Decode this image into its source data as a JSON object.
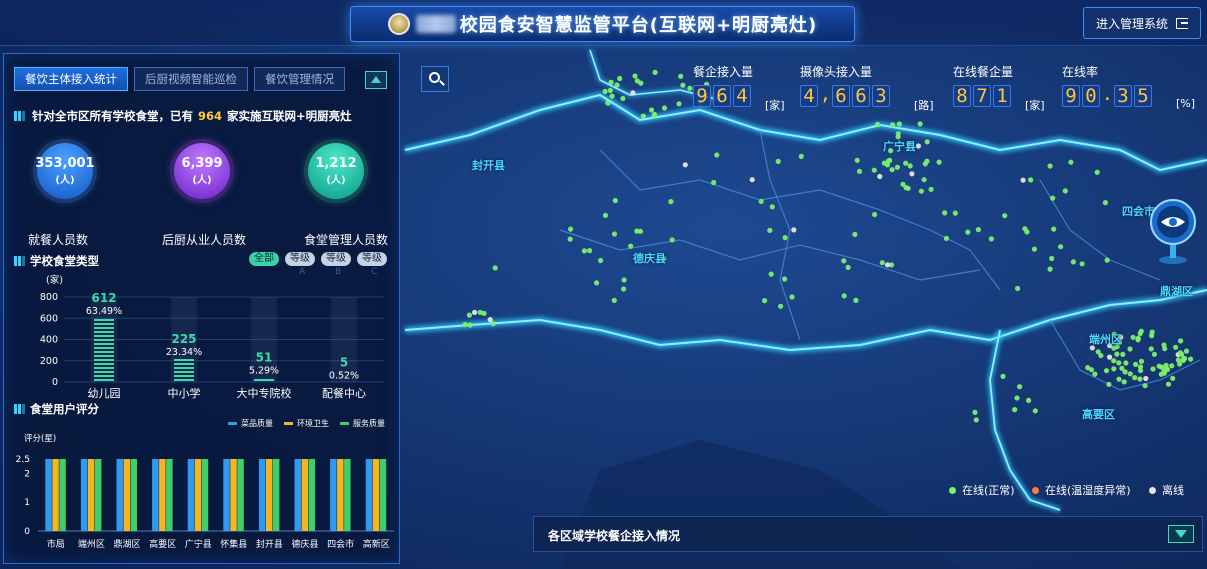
{
  "header": {
    "title": "校园食安智慧监管平台(互联网+明厨亮灶)",
    "admin_button": "进入管理系统"
  },
  "panel": {
    "tabs": [
      "餐饮主体接入统计",
      "后厨视频智能巡检",
      "餐饮管理情况"
    ],
    "summary": {
      "prefix": "针对全市区所有学校食堂，已有",
      "count": "964",
      "suffix": "家实施互联网+明厨亮灶"
    },
    "circles": [
      {
        "value": "353,001",
        "unit": "(人)",
        "label": "就餐人员数"
      },
      {
        "value": "6,399",
        "unit": "(人)",
        "label": "后厨从业人员数"
      },
      {
        "value": "1,212",
        "unit": "(人)",
        "label": "食堂管理人员数"
      }
    ],
    "canteen_title": "学校食堂类型",
    "filters": [
      {
        "label": "全部",
        "sub": ""
      },
      {
        "label": "等级",
        "sub": "A"
      },
      {
        "label": "等级",
        "sub": "B"
      },
      {
        "label": "等级",
        "sub": "C"
      }
    ],
    "rating_title": "食堂用户评分"
  },
  "metrics": [
    {
      "label": "餐企接入量",
      "digits": [
        "9",
        "6",
        "4"
      ],
      "unit": "[家]"
    },
    {
      "label": "摄像头接入量",
      "digits": [
        "4",
        ",",
        "6",
        "6",
        "3"
      ],
      "unit": "[路]"
    },
    {
      "label": "在线餐企量",
      "digits": [
        "8",
        "7",
        "1"
      ],
      "unit": "[家]"
    },
    {
      "label": "在线率",
      "digits": [
        "9",
        "0",
        ".",
        "3",
        "5"
      ],
      "unit": "[%]"
    }
  ],
  "map": {
    "counties": [
      "封开县",
      "德庆县",
      "广宁县",
      "四会市",
      "鼎湖区",
      "端州区",
      "高要区"
    ],
    "legend": [
      {
        "label": "在线(正常)",
        "color": "#7cf06a"
      },
      {
        "label": "在线(温湿度异常)",
        "color": "#ff7a3a"
      },
      {
        "label": "离线",
        "color": "#e6e6e6"
      }
    ]
  },
  "bottom_bar": {
    "label": "各区域学校餐企接入情况"
  },
  "chart_data": [
    {
      "type": "bar",
      "ylabel": "(家)",
      "ylim": [
        0,
        800
      ],
      "yticks": [
        0,
        200,
        400,
        600,
        800
      ],
      "categories": [
        "幼儿园",
        "中小学",
        "大中专院校",
        "配餐中心"
      ],
      "values": [
        612,
        225,
        51,
        5
      ],
      "percent_labels": [
        "63.49%",
        "23.34%",
        "5.29%",
        "0.52%"
      ],
      "grid": true
    },
    {
      "type": "bar",
      "ylabel": "评分(星)",
      "ylim": [
        0,
        2.5
      ],
      "yticks": [
        0,
        1,
        2,
        2.5
      ],
      "categories": [
        "市局",
        "端州区",
        "鼎湖区",
        "高要区",
        "广宁县",
        "怀集县",
        "封开县",
        "德庆县",
        "四会市",
        "高新区"
      ],
      "series": [
        {
          "name": "菜品质量",
          "color": "#2e9bf0",
          "values": [
            2.5,
            2.5,
            2.5,
            2.5,
            2.5,
            2.5,
            2.5,
            2.5,
            2.5,
            2.5
          ]
        },
        {
          "name": "环境卫生",
          "color": "#f5b51e",
          "values": [
            2.5,
            2.5,
            2.5,
            2.5,
            2.5,
            2.5,
            2.5,
            2.5,
            2.5,
            2.5
          ]
        },
        {
          "name": "服务质量",
          "color": "#3fcf6a",
          "values": [
            2.5,
            2.5,
            2.5,
            2.5,
            2.5,
            2.5,
            2.5,
            2.5,
            2.5,
            2.5
          ]
        }
      ],
      "legend_position": "top-right",
      "grid": false
    }
  ]
}
